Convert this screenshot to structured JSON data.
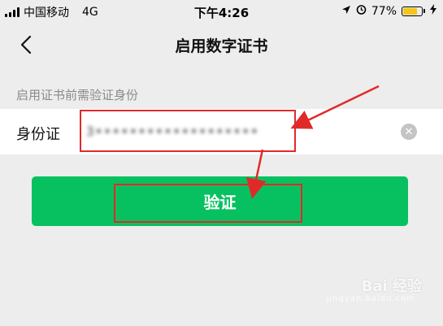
{
  "status_bar": {
    "carrier": "中国移动",
    "network": "4G",
    "time": "下午4:26",
    "battery_percent_text": "77%",
    "battery_level": 0.77,
    "battery_color": "#f5c518"
  },
  "nav": {
    "title": "启用数字证书",
    "back_icon": "chevron-left-icon"
  },
  "form": {
    "hint": "启用证书前需验证身份",
    "id_label": "身份证",
    "id_value": "3•••••••••••••••••••",
    "clear_icon": "clear-circle-icon"
  },
  "actions": {
    "verify_label": "验证",
    "verify_color": "#07c160"
  },
  "annotations": {
    "highlight_color": "#e02a2a"
  },
  "watermark": {
    "text": "Bai 经验",
    "sub": "jingyan.baidu.com"
  }
}
